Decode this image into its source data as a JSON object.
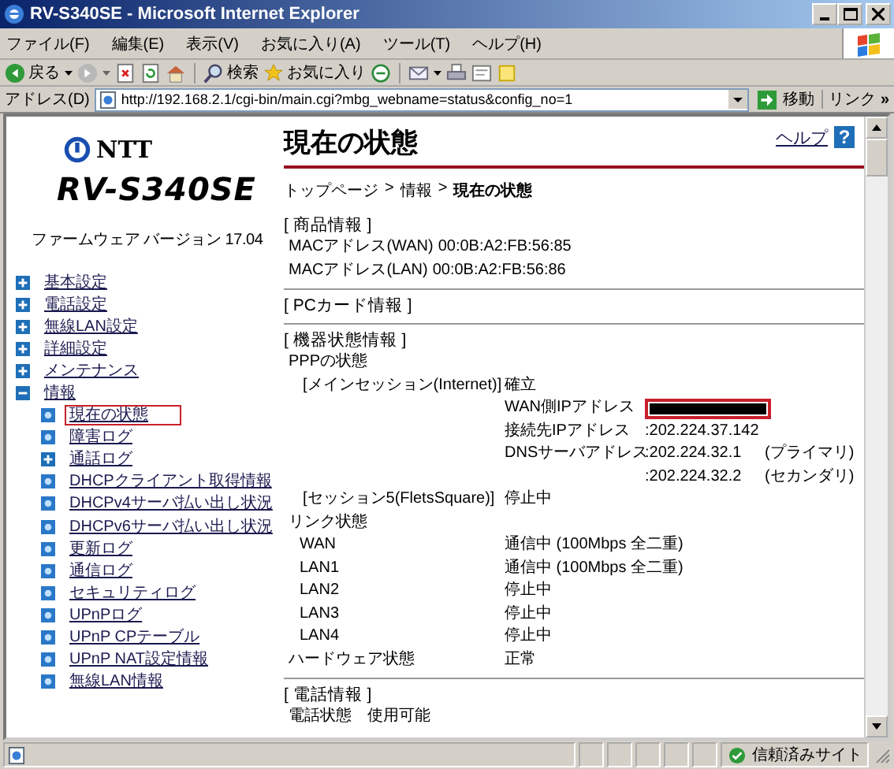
{
  "window": {
    "title": "RV-S340SE - Microsoft Internet Explorer"
  },
  "menu_bar": [
    "ファイル(F)",
    "編集(E)",
    "表示(V)",
    "お気に入り(A)",
    "ツール(T)",
    "ヘルプ(H)"
  ],
  "toolbar": {
    "back": "戻る",
    "search": "検索",
    "favorites": "お気に入り"
  },
  "address_bar": {
    "label": "アドレス(D)",
    "value": "http://192.168.2.1/cgi-bin/main.cgi?mbg_webname=status&config_no=1",
    "go": "移動",
    "links": "リンク",
    "more": "»"
  },
  "sidebar": {
    "brand": "NTT",
    "model": "RV-S340SE",
    "firmware": "ファームウェア バージョン 17.04",
    "nav": [
      {
        "label": "基本設定",
        "kind": "folder",
        "expanded": false
      },
      {
        "label": "電話設定",
        "kind": "folder",
        "expanded": false
      },
      {
        "label": "無線LAN設定",
        "kind": "folder",
        "expanded": false
      },
      {
        "label": "詳細設定",
        "kind": "folder",
        "expanded": false
      },
      {
        "label": "メンテナンス",
        "kind": "folder",
        "expanded": false
      },
      {
        "label": "情報",
        "kind": "folder",
        "expanded": true,
        "children": [
          {
            "label": "現在の状態",
            "kind": "page",
            "selected": true
          },
          {
            "label": "障害ログ",
            "kind": "page",
            "selected": false
          },
          {
            "label": "通話ログ",
            "kind": "folder",
            "expanded": false
          },
          {
            "label": "DHCPクライアント取得情報",
            "kind": "page",
            "selected": false
          },
          {
            "label": "DHCPv4サーバ払い出し状況",
            "kind": "page",
            "selected": false
          },
          {
            "label": "DHCPv6サーバ払い出し状況",
            "kind": "page",
            "selected": false
          },
          {
            "label": "更新ログ",
            "kind": "page",
            "selected": false
          },
          {
            "label": "通信ログ",
            "kind": "page",
            "selected": false
          },
          {
            "label": "セキュリティログ",
            "kind": "page",
            "selected": false
          },
          {
            "label": "UPnPログ",
            "kind": "page",
            "selected": false
          },
          {
            "label": "UPnP CPテーブル",
            "kind": "page",
            "selected": false
          },
          {
            "label": "UPnP NAT設定情報",
            "kind": "page",
            "selected": false
          },
          {
            "label": "無線LAN情報",
            "kind": "page",
            "selected": false
          }
        ]
      }
    ]
  },
  "main": {
    "title": "現在の状態",
    "help": "ヘルプ",
    "help_badge": "?",
    "breadcrumb": [
      {
        "label": "トップページ",
        "current": false
      },
      {
        "label": "情報",
        "current": false
      },
      {
        "label": "現在の状態",
        "current": true
      }
    ],
    "separator": ">",
    "product": {
      "heading": "[ 商品情報 ]",
      "rows": [
        {
          "label": "MACアドレス(WAN)",
          "value": "00:0B:A2:FB:56:85"
        },
        {
          "label": "MACアドレス(LAN)",
          "value": "00:0B:A2:FB:56:86"
        }
      ]
    },
    "pc_card": {
      "heading": "[ PCカード情報 ]"
    },
    "device": {
      "heading": "[ 機器状態情報 ]",
      "ppp_label": "PPPの状態",
      "sessions": [
        {
          "label": "[メインセッション(Internet)]",
          "status": "確立",
          "details": [
            {
              "label": "WAN側IPアドレス",
              "redacted": true,
              "highlighted": true
            },
            {
              "label": "接続先IPアドレス",
              "value": ":202.224.37.142"
            },
            {
              "label": "DNSサーバアドレス",
              "value": ":202.224.32.1",
              "note": "(プライマリ)"
            },
            {
              "value": ":202.224.32.2",
              "note": "(セカンダリ)"
            }
          ]
        },
        {
          "label": "[セッション5(FletsSquare)]",
          "status": "停止中"
        }
      ],
      "link_label": "リンク状態",
      "ports": [
        {
          "label": "WAN",
          "status": "通信中 (100Mbps 全二重)"
        },
        {
          "label": "LAN1",
          "status": "通信中 (100Mbps 全二重)"
        },
        {
          "label": "LAN2",
          "status": "停止中"
        },
        {
          "label": "LAN3",
          "status": "停止中"
        },
        {
          "label": "LAN4",
          "status": "停止中"
        }
      ],
      "hardware": {
        "label": "ハードウェア状態",
        "value": "正常"
      }
    },
    "phone": {
      "heading": "[ 電話情報 ]",
      "rows": [
        {
          "label": "電話状態",
          "value": "使用可能"
        }
      ]
    }
  },
  "status_bar": {
    "zone": "信頼済みサイト"
  }
}
